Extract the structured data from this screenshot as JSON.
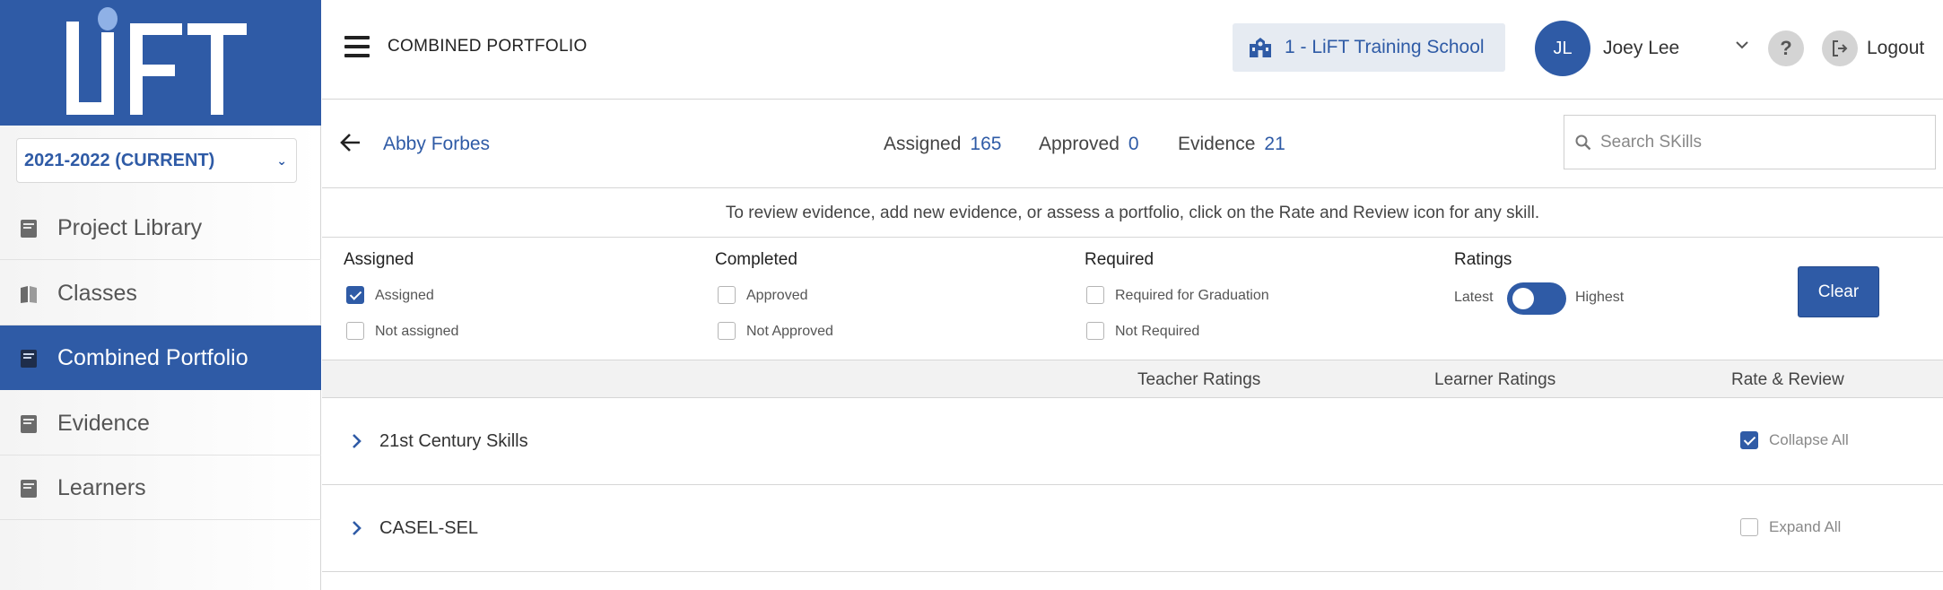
{
  "sidebar": {
    "logo_text": "LiFT",
    "year_select": {
      "value": "2021-2022 (CURRENT)"
    },
    "items": [
      {
        "label": "Project Library",
        "icon": "book-icon",
        "active": false
      },
      {
        "label": "Classes",
        "icon": "open-book-icon",
        "active": false
      },
      {
        "label": "Combined Portfolio",
        "icon": "portfolio-icon",
        "active": true
      },
      {
        "label": "Evidence",
        "icon": "evidence-icon",
        "active": false
      },
      {
        "label": "Learners",
        "icon": "learners-icon",
        "active": false
      }
    ]
  },
  "header": {
    "title": "COMBINED PORTFOLIO",
    "school": "1 - LiFT Training School",
    "user": {
      "initials": "JL",
      "name": "Joey Lee"
    },
    "help_label": "?",
    "logout_label": "Logout"
  },
  "learner": {
    "name": "Abby Forbes",
    "stats": [
      {
        "label": "Assigned",
        "value": "165"
      },
      {
        "label": "Approved",
        "value": "0"
      },
      {
        "label": "Evidence",
        "value": "21"
      }
    ],
    "search_placeholder": "Search SKills"
  },
  "instruction": "To review evidence, add new evidence, or assess a portfolio, click on the Rate and Review icon for any skill.",
  "filters": {
    "assigned": {
      "title": "Assigned",
      "options": [
        {
          "label": "Assigned",
          "checked": true
        },
        {
          "label": "Not assigned",
          "checked": false
        }
      ]
    },
    "completed": {
      "title": "Completed",
      "options": [
        {
          "label": "Approved",
          "checked": false
        },
        {
          "label": "Not Approved",
          "checked": false
        }
      ]
    },
    "required": {
      "title": "Required",
      "options": [
        {
          "label": "Required for Graduation",
          "checked": false
        },
        {
          "label": "Not Required",
          "checked": false
        }
      ]
    },
    "ratings": {
      "title": "Ratings",
      "left_label": "Latest",
      "right_label": "Highest"
    },
    "clear_label": "Clear"
  },
  "table": {
    "columns": {
      "teacher": "Teacher Ratings",
      "learner": "Learner Ratings",
      "review": "Rate & Review"
    },
    "rows": [
      {
        "name": "21st Century Skills",
        "toggle_label": "Collapse All",
        "toggle_checked": true
      },
      {
        "name": "CASEL-SEL",
        "toggle_label": "Expand All",
        "toggle_checked": false
      }
    ]
  },
  "colors": {
    "brand": "#2f5ba6",
    "header_bg": "#e6ebf2"
  }
}
